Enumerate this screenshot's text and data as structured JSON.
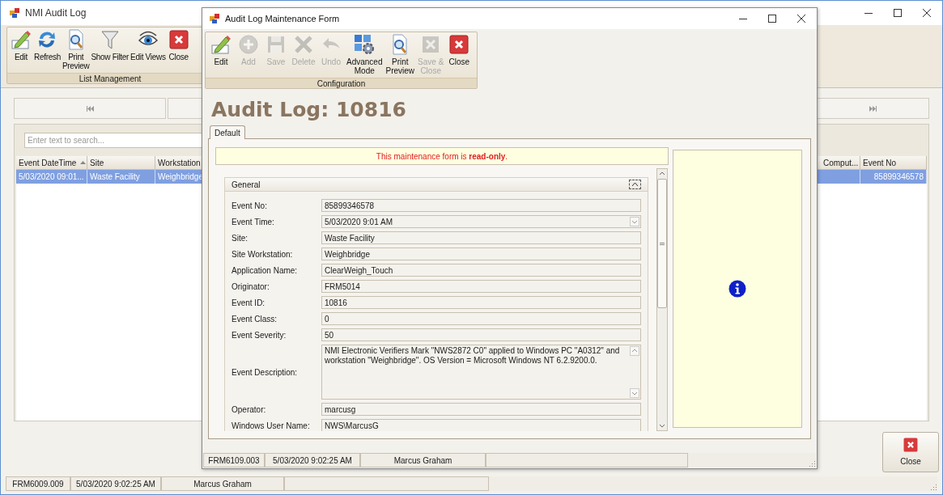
{
  "main_window": {
    "title": "NMI Audit Log",
    "toolbar": {
      "group_label": "List Management",
      "buttons": [
        {
          "kind": "edit",
          "label_lines": [
            "Edit"
          ]
        },
        {
          "kind": "refresh",
          "label_lines": [
            "Refresh"
          ]
        },
        {
          "kind": "print_preview",
          "label_lines": [
            "Print",
            "Preview"
          ]
        },
        {
          "kind": "filter",
          "label_lines": [
            "Show Filter"
          ]
        },
        {
          "kind": "eye",
          "label_lines": [
            "Edit Views"
          ]
        },
        {
          "kind": "close",
          "label_lines": [
            "Close"
          ]
        }
      ]
    },
    "search": {
      "placeholder": "Enter text to search..."
    },
    "table": {
      "columns": [
        {
          "label": "Event DateTime",
          "sorted": true
        },
        {
          "label": "Site"
        },
        {
          "label": "Workstation"
        },
        {
          "label": "Comput..."
        },
        {
          "label": "Event No"
        }
      ],
      "rows": [
        {
          "selected": true,
          "cells": [
            "5/03/2020 09:01...",
            "Waste Facility",
            "Weighbridge",
            null,
            "85899346578"
          ]
        }
      ]
    },
    "close_button": {
      "label": "Close"
    },
    "status_bar": [
      "FRM6009.009",
      "5/03/2020 9:02:25 AM",
      "Marcus Graham"
    ]
  },
  "dialog": {
    "title": "Audit Log Maintenance Form",
    "toolbar": {
      "group_label": "Configuration",
      "buttons": [
        {
          "kind": "edit",
          "label_lines": [
            "Edit"
          ],
          "disabled": false
        },
        {
          "kind": "add",
          "label_lines": [
            "Add"
          ],
          "disabled": true
        },
        {
          "kind": "save",
          "label_lines": [
            "Save"
          ],
          "disabled": true
        },
        {
          "kind": "delete",
          "label_lines": [
            "Delete"
          ],
          "disabled": true
        },
        {
          "kind": "undo",
          "label_lines": [
            "Undo"
          ],
          "disabled": true
        },
        {
          "kind": "advanced",
          "label_lines": [
            "Advanced",
            "Mode"
          ],
          "disabled": false
        },
        {
          "kind": "print_preview",
          "label_lines": [
            "Print",
            "Preview"
          ],
          "disabled": false
        },
        {
          "kind": "save_close",
          "label_lines": [
            "Save &",
            "Close"
          ],
          "disabled": true
        },
        {
          "kind": "close",
          "label_lines": [
            "Close"
          ],
          "disabled": false
        }
      ]
    },
    "heading": "Audit Log: 10816",
    "tabs": [
      {
        "label": "Default",
        "selected": true
      }
    ],
    "notice": "This maintenance form is **read-only**.",
    "group": {
      "title": "General",
      "expanded": true,
      "fields": [
        {
          "kind": "text",
          "label": "Event No:",
          "value": "85899346578"
        },
        {
          "kind": "dropdown",
          "label": "Event Time:",
          "value": "5/03/2020 9:01 AM"
        },
        {
          "kind": "text",
          "label": "Site:",
          "value": "Waste Facility"
        },
        {
          "kind": "text",
          "label": "Site Workstation:",
          "value": "Weighbridge"
        },
        {
          "kind": "text",
          "label": "Application Name:",
          "value": "ClearWeigh_Touch"
        },
        {
          "kind": "text",
          "label": "Originator:",
          "value": "FRM5014"
        },
        {
          "kind": "text",
          "label": "Event ID:",
          "value": "10816"
        },
        {
          "kind": "text",
          "label": "Event Class:",
          "value": "0"
        },
        {
          "kind": "text",
          "label": "Event Severity:",
          "value": "50"
        },
        {
          "kind": "memo",
          "label": "Event Description:",
          "value": "NMI Electronic Verifiers Mark \"NWS2872 C0\" applied to Windows PC \"A0312\" and workstation \"Weighbridge\". OS Version = Microsoft Windows NT 6.2.9200.0."
        },
        {
          "kind": "text",
          "label": "Operator:",
          "value": "marcusg"
        },
        {
          "kind": "text",
          "label": "Windows User Name:",
          "value": "NWS\\MarcusG"
        }
      ]
    },
    "status_bar": [
      "FRM6109.003",
      "5/03/2020 9:02:25 AM",
      "Marcus Graham"
    ]
  }
}
